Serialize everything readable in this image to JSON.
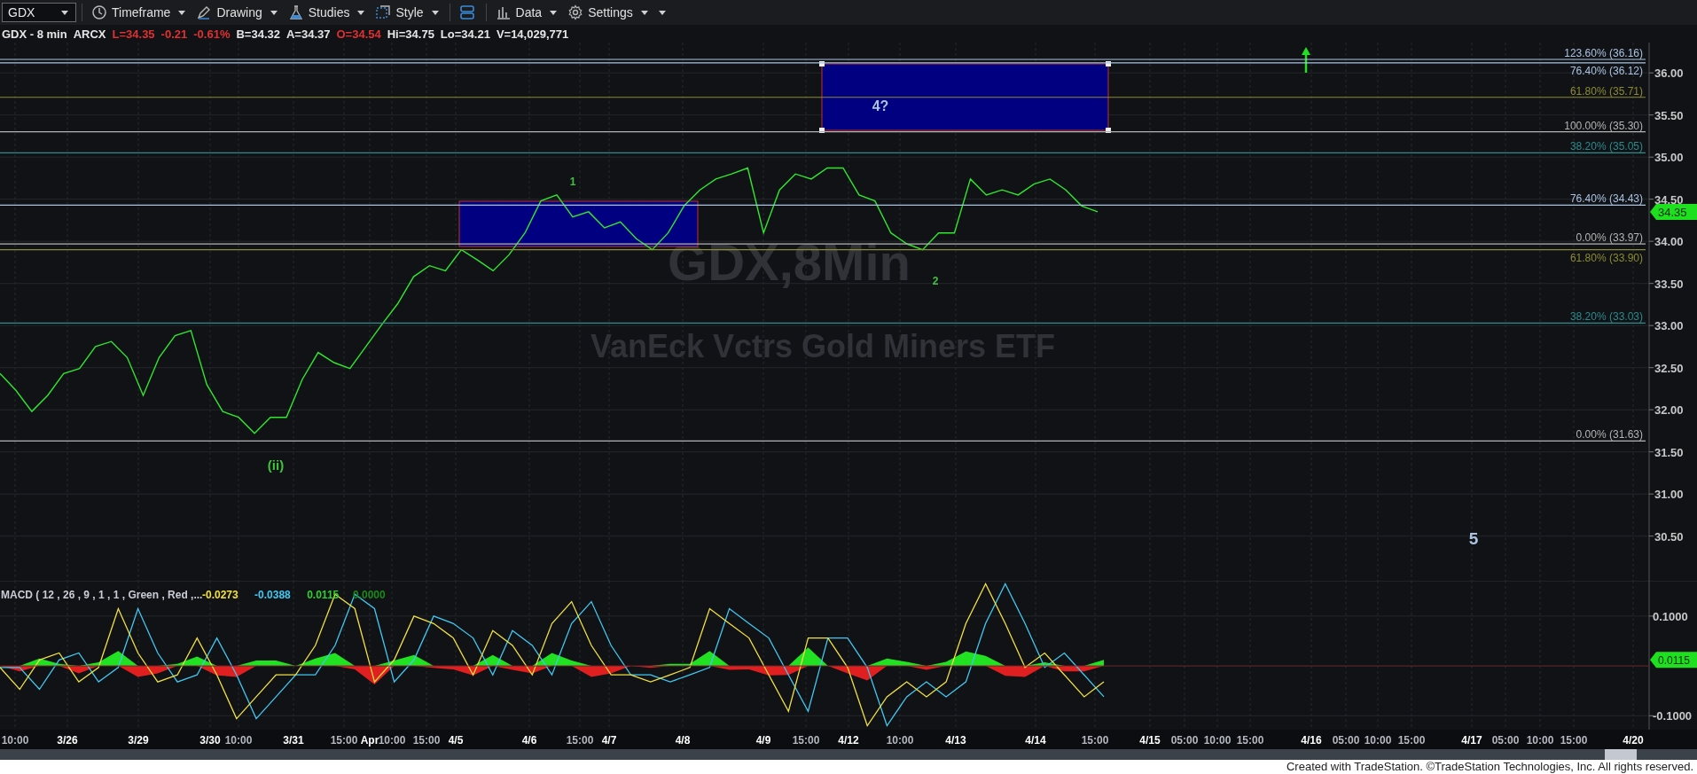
{
  "toolbar": {
    "symbol": "GDX",
    "menus": [
      {
        "kind": "clock",
        "label": "Timeframe"
      },
      {
        "kind": "pen",
        "label": "Drawing"
      },
      {
        "kind": "flask",
        "label": "Studies"
      },
      {
        "kind": "frame",
        "label": "Style"
      },
      {
        "kind": "layout"
      },
      {
        "kind": "bars",
        "label": "Data"
      },
      {
        "kind": "gear",
        "label": "Settings"
      }
    ]
  },
  "info_line": [
    {
      "text": "GDX - 8 min",
      "color": "#e6e6e6"
    },
    {
      "text": "ARCX",
      "color": "#e6e6e6"
    },
    {
      "text": "L=34.35",
      "color": "#e03030"
    },
    {
      "text": "-0.21",
      "color": "#e03030"
    },
    {
      "text": "-0.61%",
      "color": "#e03030"
    },
    {
      "text": "B=34.32",
      "color": "#e6e6e6"
    },
    {
      "text": "A=34.37",
      "color": "#e6e6e6"
    },
    {
      "text": "O=34.54",
      "color": "#e03030"
    },
    {
      "text": "Hi=34.75",
      "color": "#e6e6e6"
    },
    {
      "text": "Lo=34.21",
      "color": "#e6e6e6"
    },
    {
      "text": "V=14,029,771",
      "color": "#e6e6e6"
    }
  ],
  "price_chart": {
    "watermark": {
      "symbol": "GDX,8Min",
      "name": "VanEck Vctrs Gold Miners ETF"
    },
    "boxes": [
      {
        "selected": false
      },
      {
        "selected": true,
        "label": "4?"
      }
    ],
    "wave_labels": [
      {
        "text": "1",
        "color": "#3fc43f"
      },
      {
        "text": "2",
        "color": "#3fc43f"
      },
      {
        "text": "(ii)",
        "color": "#3fc43f"
      },
      {
        "text": "5",
        "color": "#a9c3e0"
      }
    ],
    "fib_levels": [
      {
        "label": "123.60% (36.16)",
        "color": "#a9c3e0"
      },
      {
        "label": "76.40% (36.12)",
        "color": "#a9c3e0"
      },
      {
        "label": "61.80% (35.71)",
        "color": "#8c8c30"
      },
      {
        "label": "100.00% (35.30)",
        "color": "#b4b4b4"
      },
      {
        "label": "38.20% (35.05)",
        "color": "#2a8c8c"
      },
      {
        "label": "76.40% (34.43)",
        "color": "#a9c3e0"
      },
      {
        "label": "0.00% (33.97)",
        "color": "#b4b4b4"
      },
      {
        "label": "61.80% (33.90)",
        "color": "#8c8c30"
      },
      {
        "label": "38.20% (33.03)",
        "color": "#2a8c8c"
      },
      {
        "label": "0.00% (31.63)",
        "color": "#b4b4b4"
      }
    ],
    "last_price": "34.35",
    "chart_data": {
      "type": "line",
      "grid": true,
      "ylim": [
        29.97,
        36.36
      ],
      "yticks": [
        {
          "value": 36,
          "label": "36.00"
        },
        {
          "value": 35.5,
          "label": "35.50"
        },
        {
          "value": 35,
          "label": "35.00"
        },
        {
          "value": 34.5,
          "label": "34.50"
        },
        {
          "value": 34,
          "label": "34.00"
        },
        {
          "value": 33.5,
          "label": "33.50"
        },
        {
          "value": 33,
          "label": "33.00"
        },
        {
          "value": 32.5,
          "label": "32.50"
        },
        {
          "value": 32,
          "label": "32.00"
        },
        {
          "value": 31.5,
          "label": "31.50"
        },
        {
          "value": 31,
          "label": "31.00"
        },
        {
          "value": 30.5,
          "label": "30.50"
        }
      ],
      "categories": [
        null,
        null,
        null,
        null,
        null,
        null,
        null,
        null,
        null,
        null,
        null,
        null,
        null,
        null,
        null,
        null,
        null,
        null,
        null,
        null,
        null,
        null,
        null,
        null,
        null,
        null,
        null,
        null,
        null,
        null,
        null,
        null,
        null,
        null,
        null,
        null,
        null,
        null,
        null,
        null,
        null,
        null,
        null,
        null,
        null,
        null,
        null,
        null,
        null,
        null,
        null,
        null,
        null,
        null,
        null,
        null,
        null,
        null,
        null,
        null,
        null,
        null,
        null,
        null,
        null,
        null,
        null,
        null,
        null,
        null
      ],
      "series": [
        {
          "color": "#2ee82e",
          "values": [
            32.43,
            32.23,
            31.98,
            32.17,
            32.43,
            32.49,
            32.75,
            32.81,
            32.62,
            32.17,
            32.62,
            32.88,
            32.94,
            32.3,
            31.98,
            31.91,
            31.72,
            31.91,
            31.91,
            32.36,
            32.68,
            32.56,
            32.49,
            32.75,
            33.01,
            33.26,
            33.58,
            33.71,
            33.65,
            33.9,
            33.78,
            33.65,
            33.84,
            34.1,
            34.48,
            34.55,
            34.29,
            34.35,
            34.16,
            34.23,
            34.03,
            33.9,
            34.1,
            34.42,
            34.61,
            34.74,
            34.8,
            34.87,
            34.1,
            34.61,
            34.8,
            34.74,
            34.87,
            34.87,
            34.55,
            34.48,
            34.1,
            33.97,
            33.9,
            34.1,
            34.1,
            34.74,
            34.55,
            34.61,
            34.55,
            34.68,
            34.74,
            34.61,
            34.42,
            34.35
          ]
        }
      ]
    }
  },
  "macd_panel": {
    "title": "MACD ( 12 , 26 , 9 , 1 , 1 , Green , Red ,...",
    "readings": [
      {
        "text": "-0.0273",
        "color": "#f0e040"
      },
      {
        "text": "-0.0388",
        "color": "#40c8f0"
      },
      {
        "text": "0.0115",
        "color": "#30d030"
      },
      {
        "text": "0.0000",
        "color": "#1a8a1a"
      }
    ],
    "last_value": "0.0115",
    "chart_data": {
      "type": "line",
      "grid": true,
      "ylim": [
        -0.128,
        0.171
      ],
      "yticks": [
        {
          "value": 0.1,
          "label": "0.1000"
        },
        {
          "value": -0.1,
          "label": "-0.1000"
        }
      ],
      "categories": [
        null,
        null,
        null,
        null,
        null,
        null,
        null,
        null,
        null,
        null,
        null,
        null,
        null,
        null,
        null,
        null,
        null,
        null,
        null,
        null,
        null,
        null,
        null,
        null,
        null,
        null,
        null,
        null,
        null,
        null,
        null,
        null,
        null,
        null,
        null,
        null,
        null,
        null,
        null,
        null,
        null,
        null,
        null,
        null,
        null,
        null,
        null,
        null,
        null,
        null,
        null,
        null,
        null,
        null,
        null,
        null,
        null
      ],
      "series": [
        {
          "type": "area",
          "color": "#22e022",
          "values": [
            0,
            0,
            0.015,
            0.004,
            0,
            0.007,
            0.03,
            0,
            0,
            0.004,
            0.019,
            0,
            0,
            0.011,
            0.011,
            0,
            0.015,
            0.026,
            0,
            0,
            0.011,
            0.022,
            0,
            0,
            0,
            0.022,
            0,
            0,
            0.026,
            0.011,
            0,
            0,
            0,
            0,
            0.004,
            0.004,
            0.03,
            0,
            0,
            0,
            0,
            0.037,
            0,
            0,
            0,
            0.015,
            0.008,
            0,
            0.008,
            0.029,
            0.02,
            0,
            0,
            0.007,
            0,
            0,
            0.012
          ]
        },
        {
          "type": "area",
          "color": "#e02020",
          "values": [
            0,
            -0.011,
            0,
            0,
            -0.015,
            0,
            0,
            -0.022,
            -0.015,
            0,
            0,
            -0.019,
            -0.022,
            0,
            0,
            0,
            0,
            0,
            -0.007,
            -0.037,
            0,
            0,
            -0.004,
            -0.007,
            -0.019,
            0,
            -0.008,
            -0.015,
            0,
            0,
            -0.022,
            -0.015,
            0,
            -0.004,
            0,
            0,
            0,
            -0.008,
            -0.007,
            -0.019,
            -0.018,
            0,
            0,
            -0.015,
            -0.029,
            0,
            0,
            -0.008,
            0,
            0,
            0,
            -0.02,
            -0.022,
            0,
            -0.011,
            -0.011,
            0
          ]
        },
        {
          "type": "line",
          "color": "#40c8f0",
          "values": [
            -0.003,
            -0.003,
            -0.047,
            0.012,
            0.026,
            -0.032,
            -0.003,
            0.115,
            0.026,
            -0.032,
            -0.018,
            0.056,
            -0.018,
            -0.106,
            -0.062,
            -0.018,
            -0.018,
            0.041,
            0.144,
            0.115,
            -0.032,
            0.012,
            0.1,
            0.085,
            0.056,
            -0.018,
            0.071,
            0.041,
            -0.018,
            0.085,
            0.129,
            0.041,
            -0.018,
            -0.018,
            -0.032,
            -0.018,
            -0.003,
            0.115,
            0.085,
            0.056,
            -0.018,
            -0.091,
            0.056,
            0.056,
            -0.003,
            -0.12,
            -0.062,
            -0.032,
            -0.062,
            -0.032,
            0.085,
            0.165,
            0.085,
            -0.003,
            0.026,
            -0.018,
            -0.062
          ]
        },
        {
          "type": "line",
          "color": "#f0e040",
          "values": [
            -0.003,
            -0.047,
            0.012,
            0.026,
            -0.032,
            -0.003,
            0.115,
            0.026,
            -0.032,
            -0.018,
            0.056,
            -0.018,
            -0.106,
            -0.062,
            -0.018,
            -0.018,
            0.041,
            0.144,
            0.115,
            -0.032,
            0.012,
            0.1,
            0.085,
            0.056,
            -0.018,
            0.071,
            0.041,
            -0.018,
            0.085,
            0.129,
            0.041,
            -0.018,
            -0.018,
            -0.032,
            -0.018,
            -0.003,
            0.115,
            0.085,
            0.056,
            -0.018,
            -0.091,
            0.056,
            0.056,
            -0.003,
            -0.12,
            -0.062,
            -0.032,
            -0.062,
            -0.032,
            0.085,
            0.165,
            0.085,
            -0.003,
            0.026,
            -0.018,
            -0.062,
            -0.032
          ]
        }
      ]
    }
  },
  "time_axis": [
    {
      "label": "10:00",
      "kind": "time"
    },
    {
      "label": "3/26",
      "kind": "date"
    },
    {
      "label": "3/29",
      "kind": "date"
    },
    {
      "label": "3/30",
      "kind": "date"
    },
    {
      "label": "10:00",
      "kind": "time"
    },
    {
      "label": "3/31",
      "kind": "date"
    },
    {
      "label": "15:00",
      "kind": "time"
    },
    {
      "label": "Apr",
      "kind": "date"
    },
    {
      "label": "10:00",
      "kind": "time"
    },
    {
      "label": "15:00",
      "kind": "time"
    },
    {
      "label": "4/5",
      "kind": "date"
    },
    {
      "label": "4/6",
      "kind": "date"
    },
    {
      "label": "15:00",
      "kind": "time"
    },
    {
      "label": "4/7",
      "kind": "date"
    },
    {
      "label": "4/8",
      "kind": "date"
    },
    {
      "label": "4/9",
      "kind": "date"
    },
    {
      "label": "15:00",
      "kind": "time"
    },
    {
      "label": "4/12",
      "kind": "date"
    },
    {
      "label": "10:00",
      "kind": "time"
    },
    {
      "label": "4/13",
      "kind": "date"
    },
    {
      "label": "4/14",
      "kind": "date"
    },
    {
      "label": "15:00",
      "kind": "time"
    },
    {
      "label": "4/15",
      "kind": "date"
    },
    {
      "label": "05:00",
      "kind": "time"
    },
    {
      "label": "10:00",
      "kind": "time"
    },
    {
      "label": "15:00",
      "kind": "time"
    },
    {
      "label": "4/16",
      "kind": "date"
    },
    {
      "label": "05:00",
      "kind": "time"
    },
    {
      "label": "10:00",
      "kind": "time"
    },
    {
      "label": "15:00",
      "kind": "time"
    },
    {
      "label": "4/17",
      "kind": "date"
    },
    {
      "label": "05:00",
      "kind": "time"
    },
    {
      "label": "10:00",
      "kind": "time"
    },
    {
      "label": "15:00",
      "kind": "time"
    },
    {
      "label": "4/20",
      "kind": "date"
    }
  ],
  "footer": "Created with TradeStation. ©TradeStation Technologies, Inc. All rights reserved."
}
